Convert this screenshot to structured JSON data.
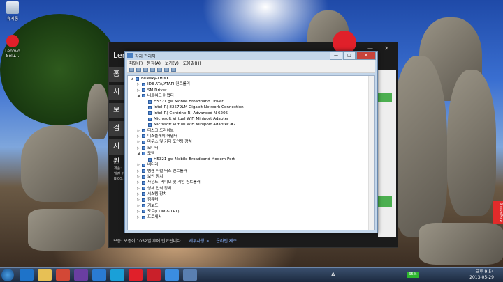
{
  "desktop": {
    "icons": [
      {
        "label": "휴지통",
        "icon": "recycle-bin-icon"
      },
      {
        "label": "Lenovo Solu...",
        "icon": "lenovo-solution-icon"
      }
    ]
  },
  "lenovo_app": {
    "title": "Len",
    "side_buttons": [
      "홈",
      "시스",
      "보안",
      "검강",
      "지원"
    ],
    "info_lines": [
      "제품:",
      "일련 번",
      "BIOS:"
    ],
    "status_text": "보증: 보증이 1052일 후에 만료됩니다.",
    "status_link_1": "세부사항 >",
    "status_link_2": "온라인 제조"
  },
  "device_manager": {
    "title": "장치 관리자",
    "menu": [
      "파일(F)",
      "동작(A)",
      "보기(V)",
      "도움말(H)"
    ],
    "tree": [
      {
        "label": "Bluesky-THINK",
        "level": 0,
        "expander": "◢"
      },
      {
        "label": "IDE ATA/ATAPI 컨트롤러",
        "level": 1,
        "expander": "▷"
      },
      {
        "label": "SM Driver",
        "level": 1,
        "expander": "▷"
      },
      {
        "label": "네트워크 어댑터",
        "level": 1,
        "expander": "◢"
      },
      {
        "label": "H5321 gw Mobile Broadband Driver",
        "level": 2,
        "expander": ""
      },
      {
        "label": "Intel(R) 82579LM Gigabit Network Connection",
        "level": 2,
        "expander": ""
      },
      {
        "label": "Intel(R) Centrino(R) Advanced-N 6205",
        "level": 2,
        "expander": ""
      },
      {
        "label": "Microsoft Virtual WiFi Miniport Adapter",
        "level": 2,
        "expander": ""
      },
      {
        "label": "Microsoft Virtual WiFi Miniport Adapter #2",
        "level": 2,
        "expander": ""
      },
      {
        "label": "디스크 드라이브",
        "level": 1,
        "expander": "▷"
      },
      {
        "label": "디스플레이 어댑터",
        "level": 1,
        "expander": "▷"
      },
      {
        "label": "마우스 및 기타 포인팅 장치",
        "level": 1,
        "expander": "▷"
      },
      {
        "label": "모니터",
        "level": 1,
        "expander": "▷"
      },
      {
        "label": "모뎀",
        "level": 1,
        "expander": "◢"
      },
      {
        "label": "H5321 gw Mobile Broadband Modem Port",
        "level": 2,
        "expander": ""
      },
      {
        "label": "배터리",
        "level": 1,
        "expander": "▷"
      },
      {
        "label": "범용 직렬 버스 컨트롤러",
        "level": 1,
        "expander": "▷"
      },
      {
        "label": "보안 장치",
        "level": 1,
        "expander": "▷"
      },
      {
        "label": "사운드, 비디오 및 게임 컨트롤러",
        "level": 1,
        "expander": "▷"
      },
      {
        "label": "생체 인식 장치",
        "level": 1,
        "expander": "▷"
      },
      {
        "label": "시스템 장치",
        "level": 1,
        "expander": "▷"
      },
      {
        "label": "컴퓨터",
        "level": 1,
        "expander": "▷"
      },
      {
        "label": "키보드",
        "level": 1,
        "expander": "▷"
      },
      {
        "label": "포트(COM & LPT)",
        "level": 1,
        "expander": "▷"
      },
      {
        "label": "프로세서",
        "level": 1,
        "expander": "▷"
      }
    ]
  },
  "taskbar": {
    "apps": [
      "ie-icon",
      "explorer-icon",
      "chrome-icon",
      "outlook-icon",
      "lync-icon",
      "photoshop-icon",
      "lenovo-icon",
      "lenovo2-icon",
      "media-icon",
      "device-manager-icon"
    ],
    "tray_lang": "A",
    "battery": "95%",
    "time": "오후 9:54",
    "date": "2013-05-29"
  },
  "side_tab": "SimpleMap"
}
